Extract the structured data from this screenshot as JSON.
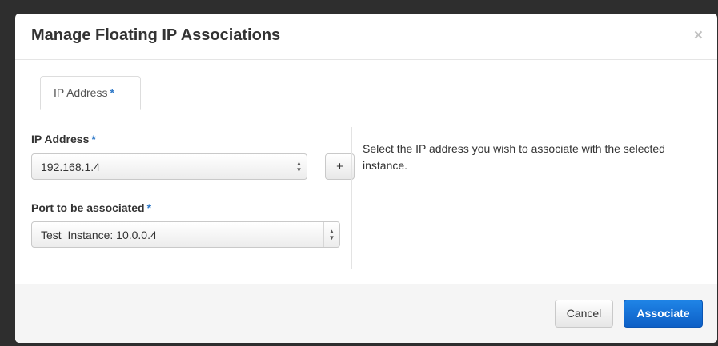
{
  "modal": {
    "title": "Manage Floating IP Associations",
    "close_symbol": "×"
  },
  "tabs": [
    {
      "label": "IP Address",
      "required_mark": "*",
      "active": true
    }
  ],
  "form": {
    "ip_address": {
      "label": "IP Address",
      "required_mark": "*",
      "selected_value": "192.168.1.4",
      "add_button_label": "+"
    },
    "port": {
      "label": "Port to be associated",
      "required_mark": "*",
      "selected_value": "Test_Instance: 10.0.0.4"
    }
  },
  "help": {
    "text": "Select the IP address you wish to associate with the selected instance."
  },
  "footer": {
    "cancel_label": "Cancel",
    "associate_label": "Associate"
  },
  "colors": {
    "primary": "#1372d6",
    "required": "#2f79c8",
    "backdrop": "#2e2e2e"
  },
  "icons": {
    "close": "close-icon",
    "select_arrows": "select-arrows-icon",
    "add": "plus-icon"
  }
}
